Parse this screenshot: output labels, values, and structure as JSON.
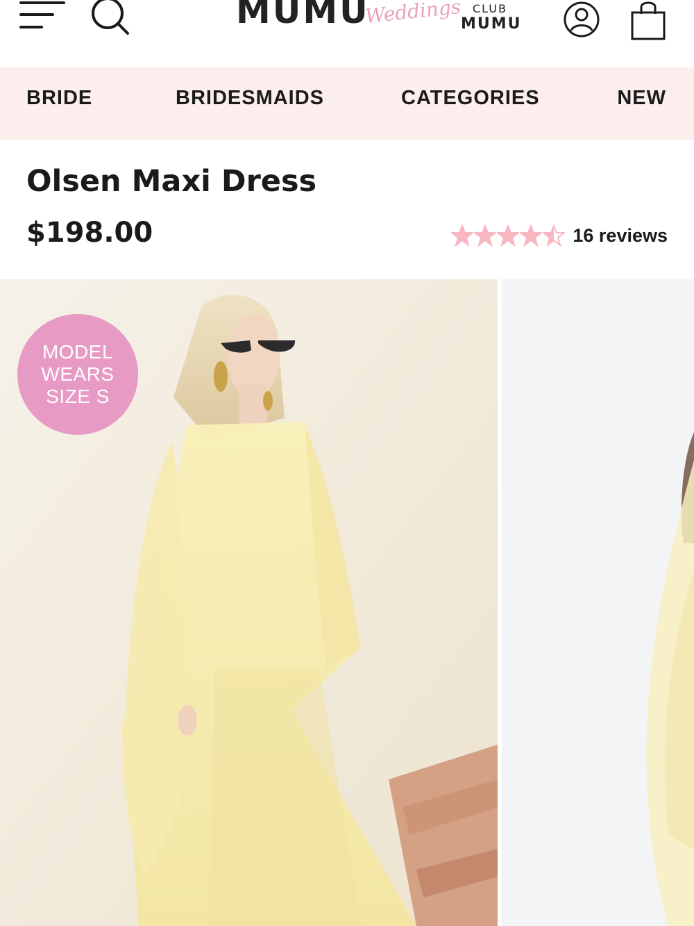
{
  "header": {
    "logo_main": "MUMU",
    "logo_script": "Weddings",
    "club_top": "CLUB",
    "club_bottom": "MUMU",
    "icons": [
      "menu-icon",
      "search-icon",
      "account-icon",
      "shopping-bag-icon"
    ]
  },
  "nav": {
    "items": [
      {
        "label": "BRIDE"
      },
      {
        "label": "BRIDESMAIDS"
      },
      {
        "label": "CATEGORIES"
      },
      {
        "label": "NEW"
      }
    ]
  },
  "product": {
    "title": "Olsen Maxi Dress",
    "price": "$198.00",
    "rating": 4.5,
    "rating_max": 5,
    "reviews": "16 reviews"
  },
  "gallery": {
    "badge_lines": [
      "MODEL",
      "WEARS",
      "SIZE S"
    ]
  },
  "colors": {
    "nav_bg": "#fdeeee",
    "star": "#f6b7c1",
    "badge": "#e79ac3",
    "dress": "#f7ecaa",
    "text": "#1a1a1a"
  }
}
